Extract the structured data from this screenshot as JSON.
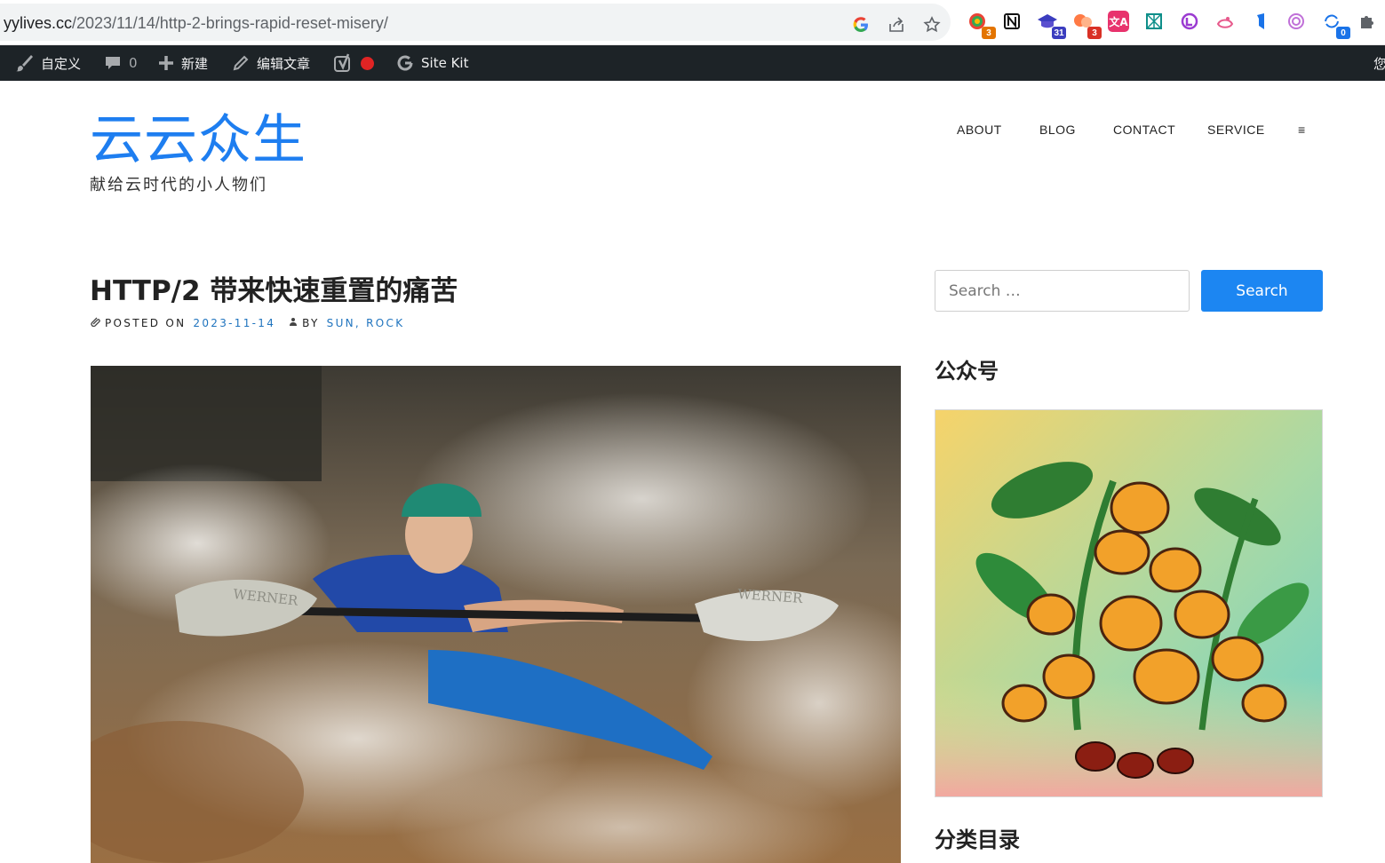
{
  "browser": {
    "url_host": "yylives.cc",
    "url_path": "/2023/11/14/http-2-brings-rapid-reset-misery/",
    "extensions": [
      {
        "name": "colorful-circle-ext-icon",
        "badge": "3",
        "badge_color": "#e37400"
      },
      {
        "name": "notion-icon",
        "badge": ""
      },
      {
        "name": "graduation-cap-ext-icon",
        "badge": "31",
        "badge_color": "#3b3dbf"
      },
      {
        "name": "orange-circles-ext-icon",
        "badge": "3",
        "badge_color": "#d93025"
      },
      {
        "name": "translate-ext-icon",
        "badge": ""
      },
      {
        "name": "teal-grid-ext-icon",
        "badge": ""
      },
      {
        "name": "purple-circle-ext-icon",
        "badge": ""
      },
      {
        "name": "pink-fish-ext-icon",
        "badge": ""
      },
      {
        "name": "blue-arrow-ext-icon",
        "badge": ""
      },
      {
        "name": "openai-icon",
        "badge": ""
      },
      {
        "name": "refresh-ext-icon",
        "badge": "0",
        "badge_color": "#1a73e8"
      },
      {
        "name": "puzzle-icon",
        "badge": ""
      }
    ]
  },
  "admin_bar": {
    "customize": "自定义",
    "comments_count": "0",
    "new": "新建",
    "edit_post": "编辑文章",
    "site_kit": "Site Kit",
    "edge_text": "您"
  },
  "site": {
    "title": "云云众生",
    "tagline": "献给云时代的小人物们",
    "accent": "#1e7ef0"
  },
  "nav": {
    "items": [
      "ABOUT",
      "BLOG",
      "CONTACT",
      "SERVICE"
    ],
    "menu_toggle": "≡"
  },
  "post": {
    "title": "HTTP/2 带来快速重置的痛苦",
    "posted_on_label": "POSTED ON",
    "date": "2023-11-14",
    "by_label": "BY",
    "authors": "SUN, ROCK",
    "image_paddle_text": "WERNER"
  },
  "sidebar": {
    "search_placeholder": "Search …",
    "search_button": "Search",
    "widget_wechat_title": "公众号",
    "widget_categories_title": "分类目录",
    "button_color": "#1c86f2"
  }
}
